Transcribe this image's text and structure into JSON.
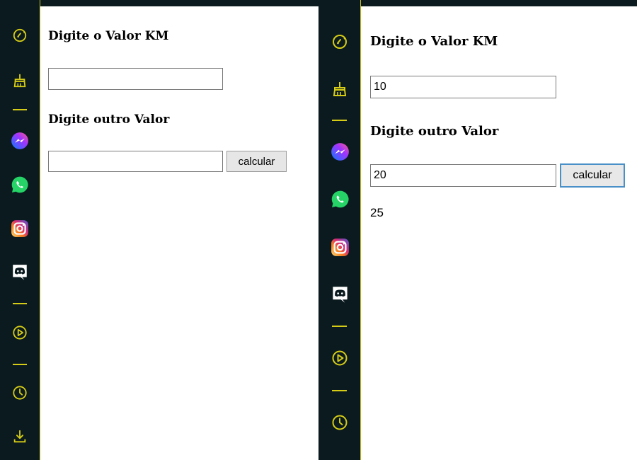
{
  "left": {
    "km_label": "Digite o Valor KM",
    "km_value": "",
    "other_label": "Digite outro Valor",
    "other_value": "",
    "button_label": "calcular",
    "result": ""
  },
  "right": {
    "km_label": "Digite o Valor KM",
    "km_value": "10",
    "other_label": "Digite outro Valor",
    "other_value": "20",
    "button_label": "calcular",
    "result": "25"
  },
  "sidebar": {
    "icons": [
      "speedometer-icon",
      "broom-icon",
      "messenger-icon",
      "whatsapp-icon",
      "instagram-icon",
      "discord-icon",
      "play-icon",
      "clock-icon",
      "download-icon"
    ]
  },
  "colors": {
    "sidebar_bg": "#0a1a1f",
    "accent_yellow": "#d6cc16",
    "whatsapp": "#25d366",
    "focus_blue": "#4a90c8"
  }
}
